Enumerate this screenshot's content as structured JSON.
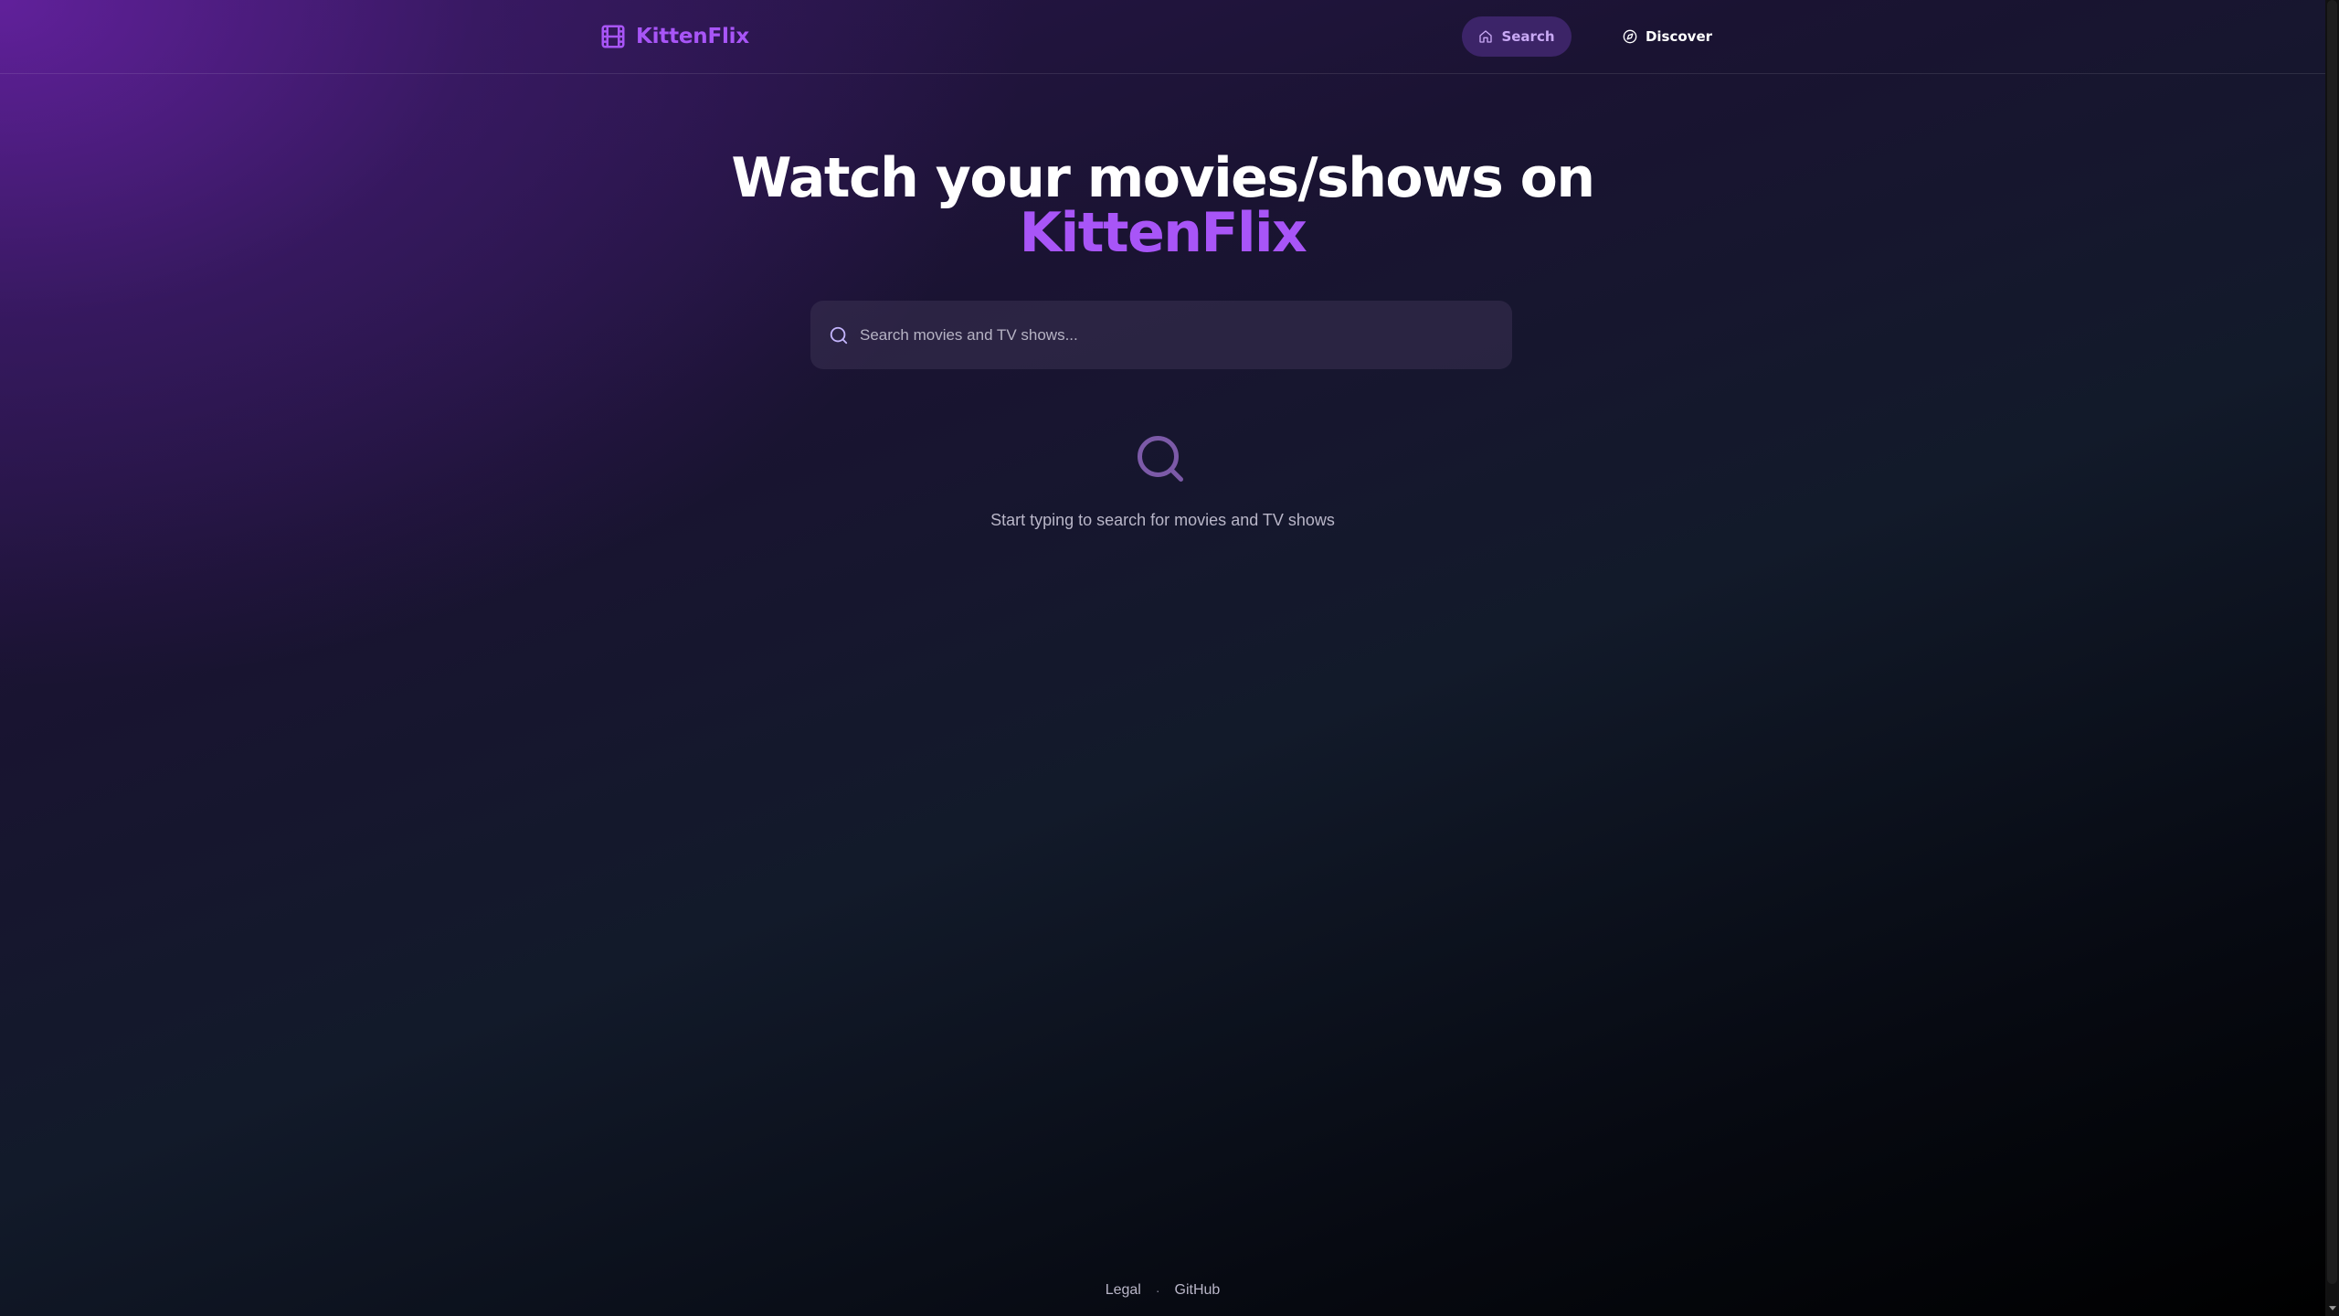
{
  "header": {
    "brand": {
      "name": "KittenFlix",
      "icon": "film-icon"
    },
    "nav": [
      {
        "label": "Search",
        "icon": "home-icon",
        "active": true
      },
      {
        "label": "Discover",
        "icon": "compass-icon",
        "active": false
      }
    ]
  },
  "hero": {
    "title_line1": "Watch your movies/shows on",
    "title_line2": "KittenFlix"
  },
  "search": {
    "placeholder": "Search movies and TV shows...",
    "value": "",
    "icon": "search-icon"
  },
  "empty_state": {
    "icon": "search-icon",
    "message": "Start typing to search for movies and TV shows"
  },
  "footer": {
    "links": [
      "Legal",
      "GitHub"
    ],
    "separator": "·"
  },
  "colors": {
    "accent": "#a855f7",
    "nav_active_bg": "#3b2a63",
    "text_muted": "#b9b6c8"
  }
}
